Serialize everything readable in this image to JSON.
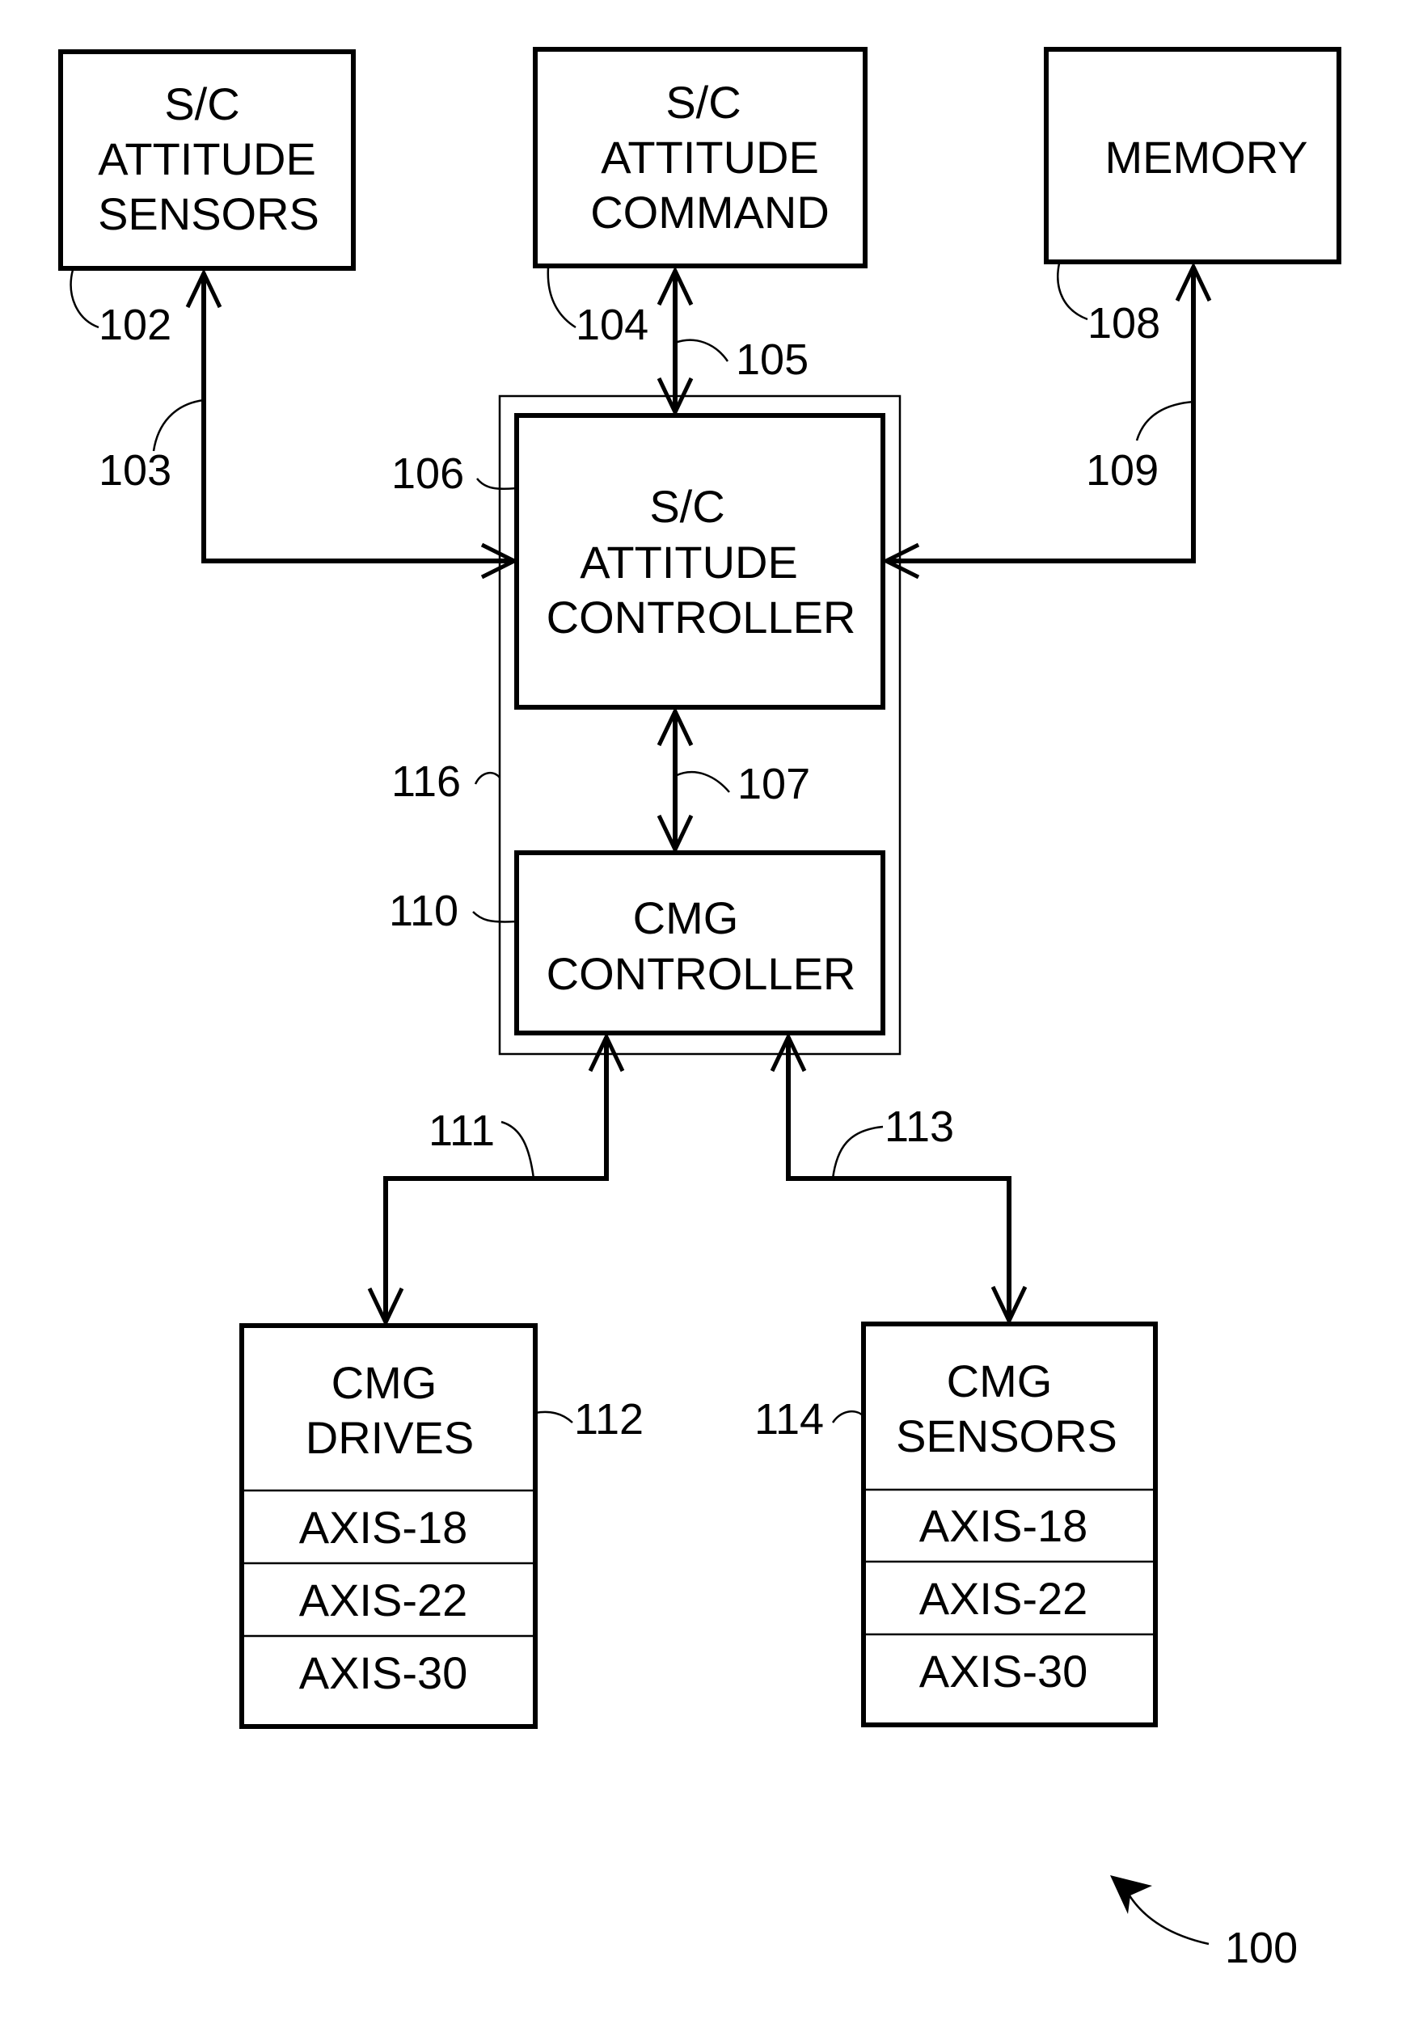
{
  "figure": {
    "reference": "100",
    "blocks": {
      "attitude_sensors": {
        "ref": "102",
        "lines": [
          "S/C",
          "ATTITUDE",
          "SENSORS"
        ]
      },
      "attitude_command": {
        "ref": "104",
        "lines": [
          "S/C",
          "ATTITUDE",
          "COMMAND"
        ]
      },
      "memory": {
        "ref": "108",
        "lines": [
          "MEMORY"
        ]
      },
      "attitude_controller": {
        "ref": "106",
        "lines": [
          "S/C",
          "ATTITUDE",
          "CONTROLLER"
        ]
      },
      "cmg_controller": {
        "ref": "110",
        "lines": [
          "CMG",
          "CONTROLLER"
        ]
      },
      "control_module": {
        "ref": "116"
      },
      "cmg_drives": {
        "ref": "112",
        "lines": [
          "CMG",
          "DRIVES"
        ],
        "axes": [
          "AXIS-18",
          "AXIS-22",
          "AXIS-30"
        ]
      },
      "cmg_sensors": {
        "ref": "114",
        "lines": [
          "CMG",
          "SENSORS"
        ],
        "axes": [
          "AXIS-18",
          "AXIS-22",
          "AXIS-30"
        ]
      }
    },
    "connections": {
      "sensors_link": "103",
      "command_link": "105",
      "controller_link": "107",
      "memory_link": "109",
      "drives_link": "111",
      "cmg_sensors_link": "113"
    }
  }
}
